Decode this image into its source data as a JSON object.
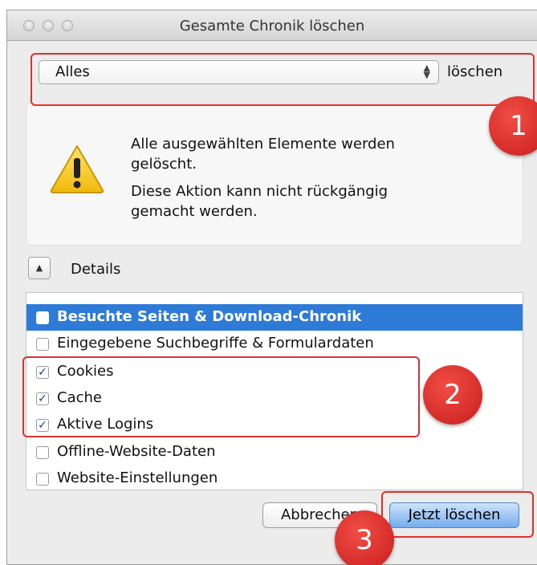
{
  "window": {
    "title": "Gesamte Chronik löschen"
  },
  "range": {
    "selected": "Alles",
    "suffix": "löschen"
  },
  "warning": {
    "line1": "Alle ausgewählten Elemente werden",
    "line2": "gelöscht.",
    "line3": "Diese Aktion kann nicht rückgängig",
    "line4": "gemacht werden."
  },
  "details": {
    "label": "Details"
  },
  "items": [
    {
      "label": "Besuchte Seiten & Download-Chronik",
      "checked": false,
      "selected": true
    },
    {
      "label": "Eingegebene Suchbegriffe & Formulardaten",
      "checked": false,
      "selected": false
    },
    {
      "label": "Cookies",
      "checked": true,
      "selected": false
    },
    {
      "label": "Cache",
      "checked": true,
      "selected": false
    },
    {
      "label": "Aktive Logins",
      "checked": true,
      "selected": false
    },
    {
      "label": "Offline-Website-Daten",
      "checked": false,
      "selected": false
    },
    {
      "label": "Website-Einstellungen",
      "checked": false,
      "selected": false
    }
  ],
  "buttons": {
    "cancel": "Abbrechen",
    "confirm": "Jetzt löschen"
  },
  "annotations": {
    "badge1": "1",
    "badge2": "2",
    "badge3": "3",
    "color": "#e0302e"
  },
  "colors": {
    "selection": "#2e7bd7",
    "primary_button": "#73acef"
  }
}
